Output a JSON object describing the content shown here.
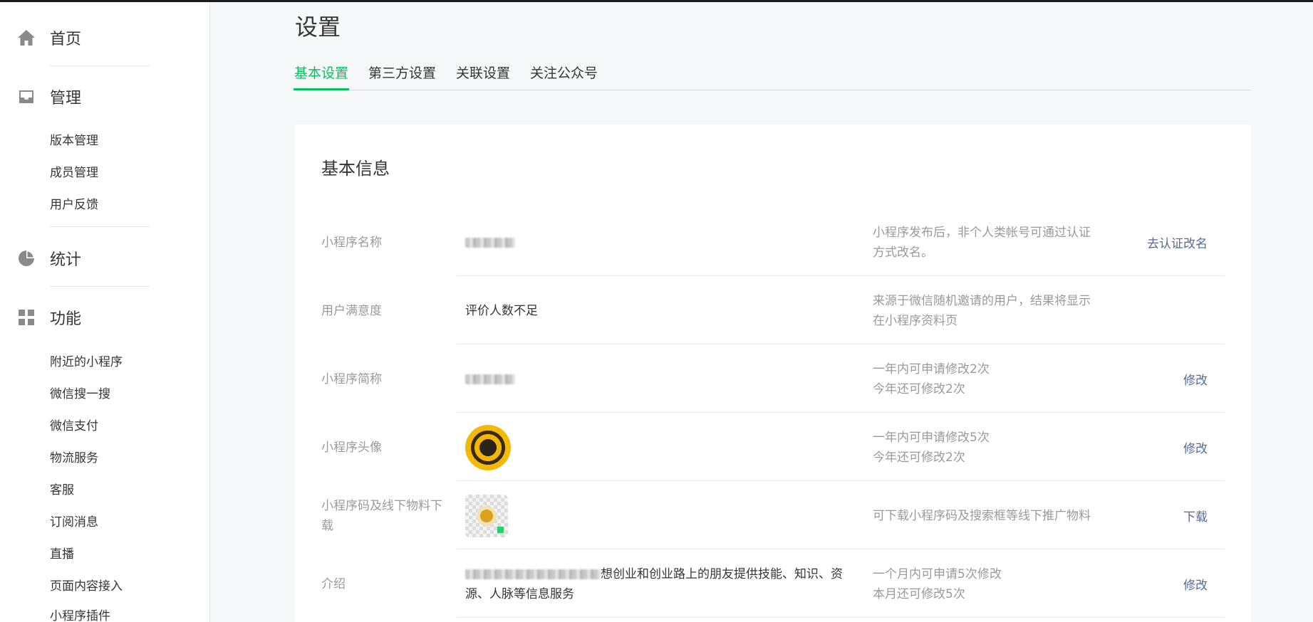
{
  "sidebar": {
    "home": {
      "label": "首页",
      "icon": "home-icon"
    },
    "manage": {
      "label": "管理",
      "icon": "inbox-icon",
      "items": [
        "版本管理",
        "成员管理",
        "用户反馈"
      ]
    },
    "stats": {
      "label": "统计",
      "icon": "pie-chart-icon"
    },
    "features": {
      "label": "功能",
      "icon": "grid-icon",
      "items": [
        "附近的小程序",
        "微信搜一搜",
        "微信支付",
        "物流服务",
        "客服",
        "订阅消息",
        "直播",
        "页面内容接入",
        "小程序插件"
      ]
    }
  },
  "main": {
    "title": "设置",
    "tabs": [
      "基本设置",
      "第三方设置",
      "关联设置",
      "关注公众号"
    ],
    "active_tab": 0,
    "card": {
      "title": "基本信息",
      "rows": [
        {
          "label": "小程序名称",
          "value": "",
          "desc": "小程序发布后，非个人类帐号可通过认证方式改名。",
          "action": "去认证改名"
        },
        {
          "label": "用户满意度",
          "value": "评价人数不足",
          "desc": "来源于微信随机邀请的用户，结果将显示在小程序资料页",
          "action": ""
        },
        {
          "label": "小程序简称",
          "value": "",
          "desc": "一年内可申请修改2次\n今年还可修改2次",
          "action": "修改"
        },
        {
          "label": "小程序头像",
          "value": "",
          "desc": "一年内可申请修改5次\n今年还可修改2次",
          "action": "修改"
        },
        {
          "label": "小程序码及线下物料下载",
          "value": "",
          "desc": "可下载小程序码及搜索框等线下推广物料",
          "action": "下载"
        },
        {
          "label": "介绍",
          "value": "想创业和创业路上的朋友提供技能、知识、资源、人脉等信息服务",
          "desc": "一个月内可申请5次修改\n本月还可修改5次",
          "action": "修改"
        }
      ]
    }
  },
  "colors": {
    "accent": "#07c160",
    "link": "#576b95",
    "muted": "#9a9a9a",
    "text": "#353535"
  }
}
